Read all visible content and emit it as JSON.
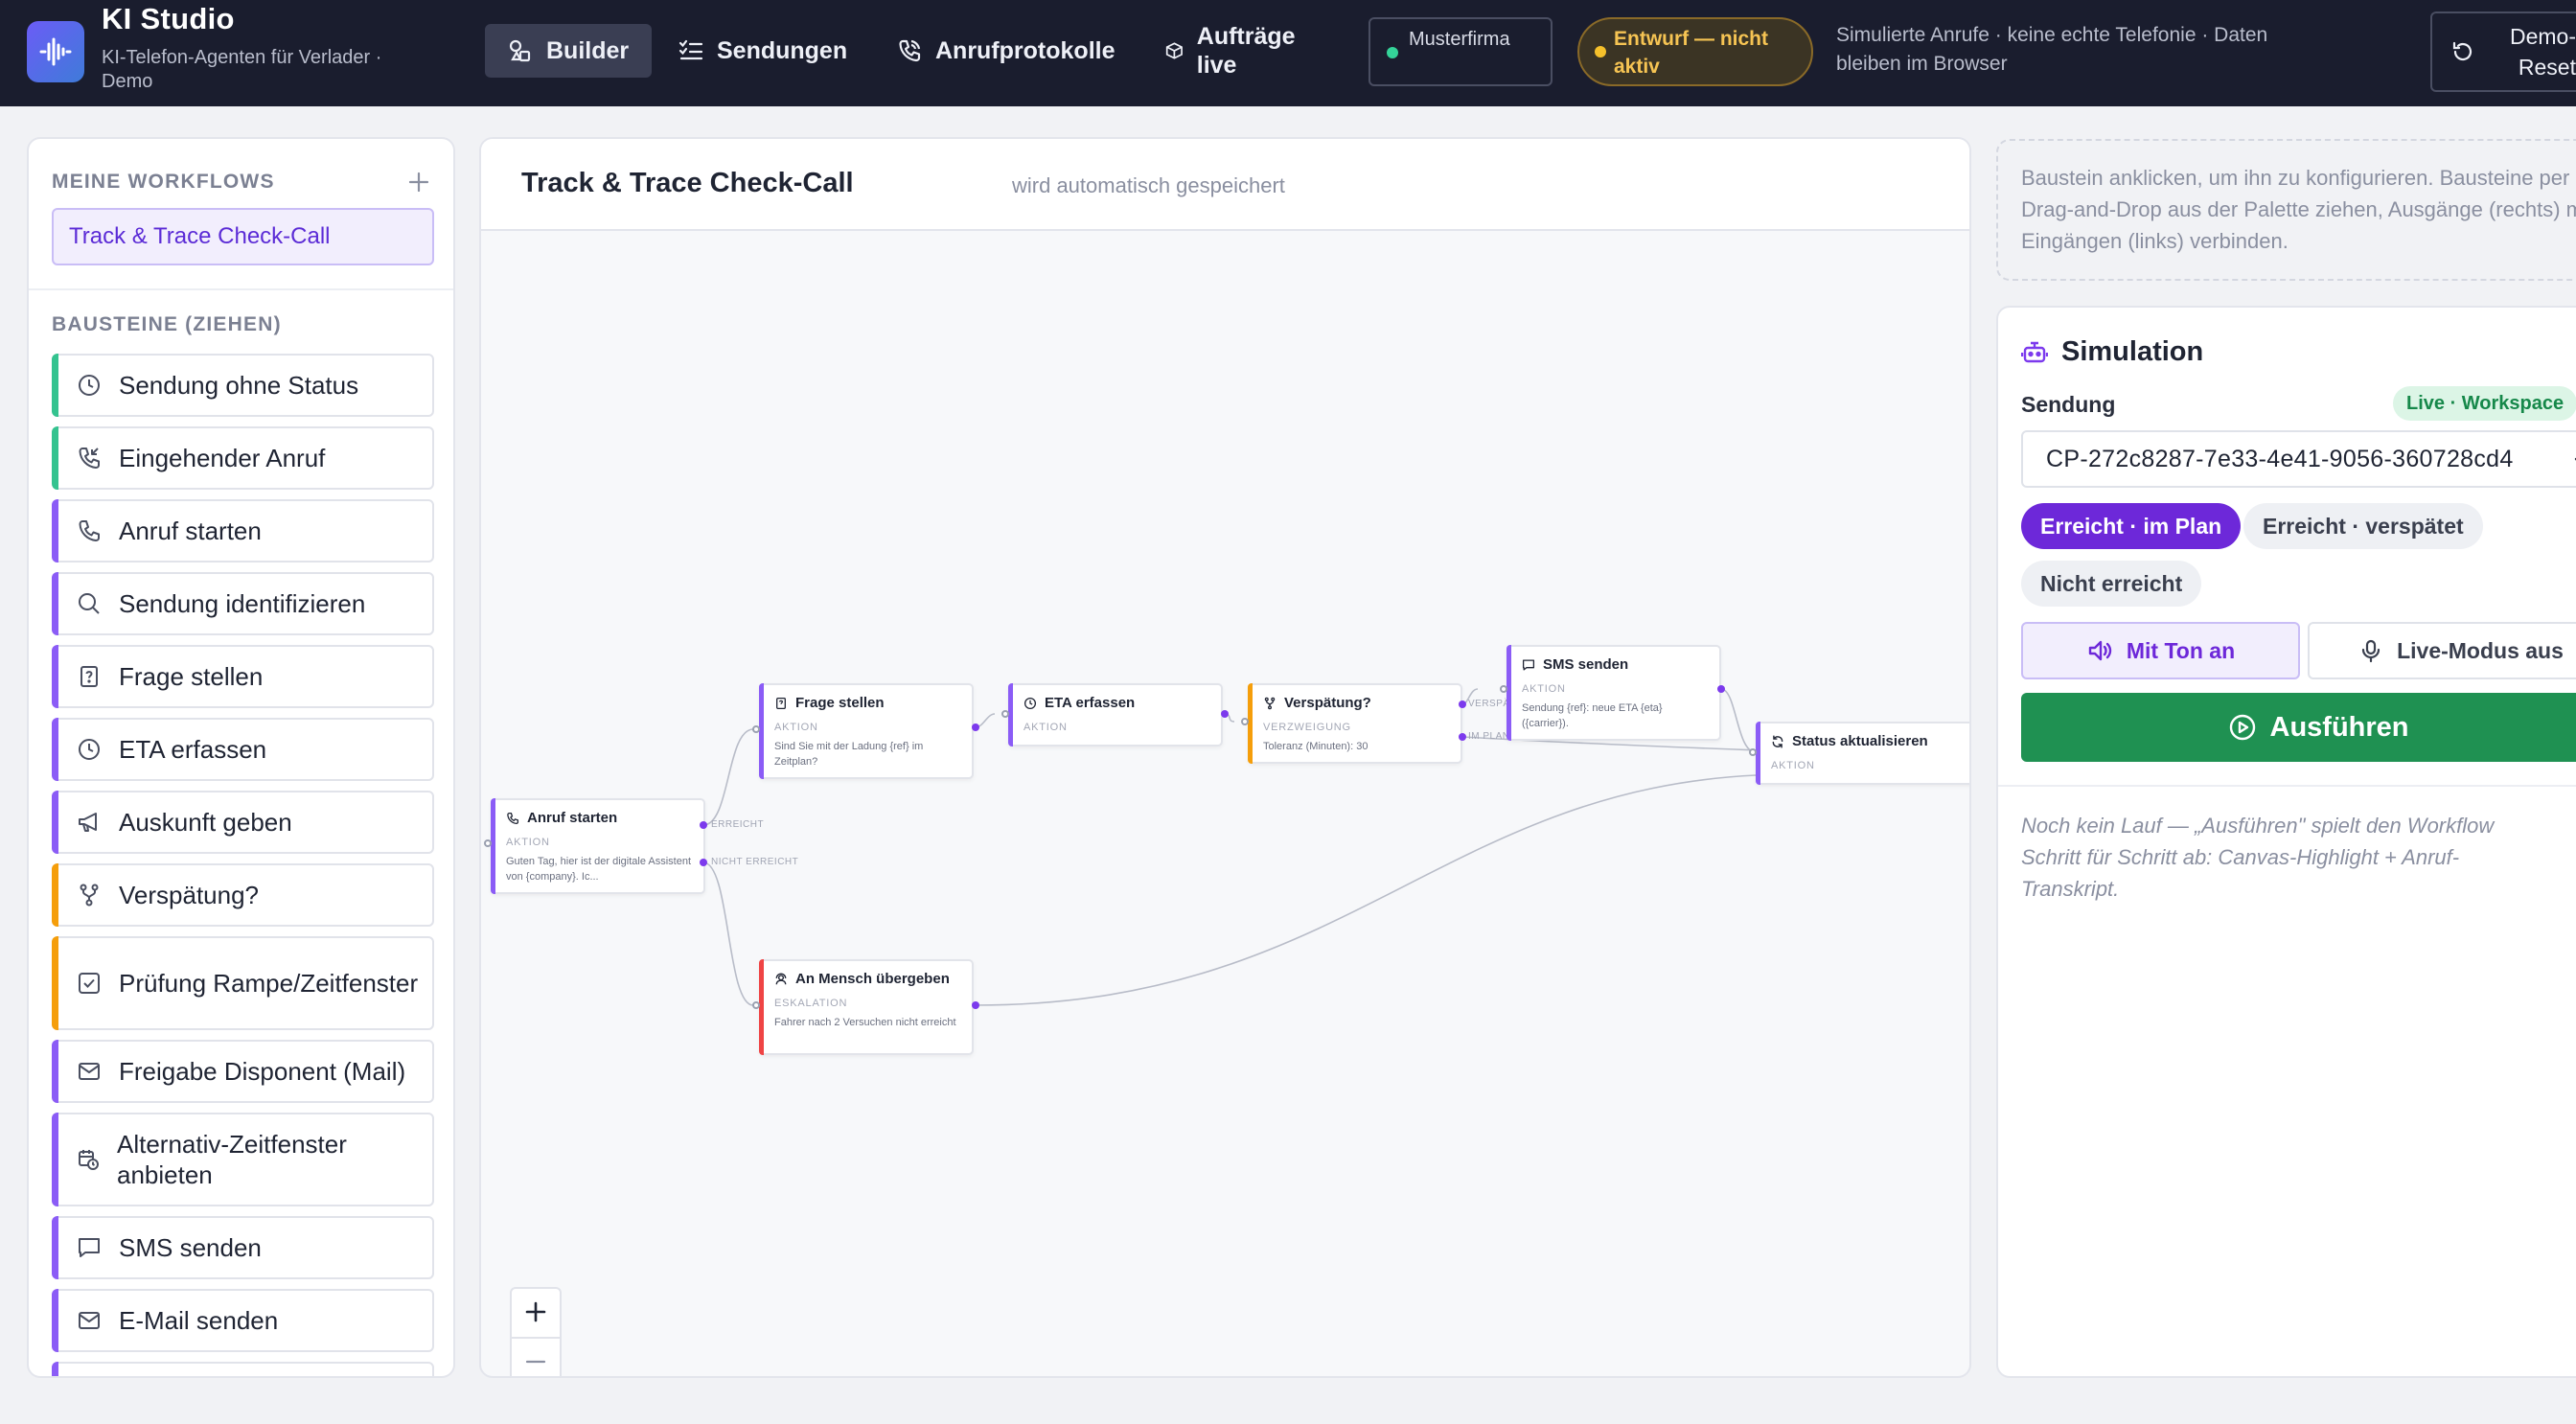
{
  "header": {
    "title": "KI Studio",
    "subtitle": "KI-Telefon-Agenten für Verlader · Demo",
    "nav": [
      {
        "label": "Builder",
        "icon": "shapes-icon",
        "active": true
      },
      {
        "label": "Sendungen",
        "icon": "checklist-icon"
      },
      {
        "label": "Anrufprotokolle",
        "icon": "phone-icon"
      },
      {
        "label": "Aufträge live",
        "icon": "package-icon"
      }
    ],
    "company": "Musterfirma",
    "status": "Entwurf — nicht aktiv",
    "note": "Simulierte Anrufe · keine echte Telefonie · Daten bleiben im Browser",
    "reset_label": "Demo-Reset"
  },
  "sidebar": {
    "workflows_title": "MEINE WORKFLOWS",
    "workflows": [
      "Track & Trace Check-Call"
    ],
    "palette_title": "BAUSTEINE (ZIEHEN)",
    "palette": [
      {
        "label": "Sendung ohne Status",
        "icon": "clock-icon",
        "accent": "#34c38f"
      },
      {
        "label": "Eingehender Anruf",
        "icon": "phone-incoming-icon",
        "accent": "#34c38f"
      },
      {
        "label": "Anruf starten",
        "icon": "phone-icon",
        "accent": "#8b5cf6"
      },
      {
        "label": "Sendung identifizieren",
        "icon": "search-icon",
        "accent": "#8b5cf6"
      },
      {
        "label": "Frage stellen",
        "icon": "question-file-icon",
        "accent": "#8b5cf6"
      },
      {
        "label": "ETA erfassen",
        "icon": "clock-icon",
        "accent": "#8b5cf6"
      },
      {
        "label": "Auskunft geben",
        "icon": "megaphone-icon",
        "accent": "#8b5cf6"
      },
      {
        "label": "Verspätung?",
        "icon": "branch-icon",
        "accent": "#f59e0b"
      },
      {
        "label": "Prüfung Rampe/Zeitfenster",
        "icon": "checkbox-icon",
        "accent": "#f59e0b"
      },
      {
        "label": "Freigabe Disponent (Mail)",
        "icon": "mail-icon",
        "accent": "#8b5cf6"
      },
      {
        "label": "Alternativ-Zeitfenster anbieten",
        "icon": "calendar-clock-icon",
        "accent": "#8b5cf6"
      },
      {
        "label": "SMS senden",
        "icon": "message-icon",
        "accent": "#8b5cf6"
      },
      {
        "label": "E-Mail senden",
        "icon": "mail-icon",
        "accent": "#8b5cf6"
      }
    ]
  },
  "canvas": {
    "title": "Track & Trace Check-Call",
    "saved": "wird automatisch gespeichert",
    "nodes": {
      "start": {
        "title": "Anruf starten",
        "type": "AKTION",
        "desc": "Guten Tag, hier ist der digitale Assistent von {company}. Ic...",
        "accent": "#8b5cf6"
      },
      "question": {
        "title": "Frage stellen",
        "type": "AKTION",
        "desc": "Sind Sie mit der Ladung {ref} im Zeitplan?",
        "accent": "#8b5cf6"
      },
      "eta": {
        "title": "ETA erfassen",
        "type": "AKTION",
        "desc": "",
        "accent": "#8b5cf6"
      },
      "delay": {
        "title": "Verspätung?",
        "type": "VERZWEIGUNG",
        "desc": "Toleranz (Minuten): 30",
        "accent": "#f59e0b"
      },
      "sms": {
        "title": "SMS senden",
        "type": "AKTION",
        "desc": "Sendung {ref}: neue ETA {eta} ({carrier}).",
        "accent": "#8b5cf6"
      },
      "status": {
        "title": "Status aktualisieren",
        "type": "AKTION",
        "desc": "",
        "accent": "#8b5cf6"
      },
      "human": {
        "title": "An Mensch übergeben",
        "type": "ESKALATION",
        "desc": "Fahrer nach 2 Versuchen nicht erreicht",
        "accent": "#ef4444"
      }
    },
    "ports": {
      "reached": "ERREICHT",
      "not_reached": "NICHT ERREICHT",
      "late": "VERSPÄTET",
      "on_plan": "IM PLAN"
    }
  },
  "inspector": {
    "hint": "Baustein anklicken, um ihn zu konfigurieren. Bausteine per Drag-and-Drop aus der Palette ziehen, Ausgänge (rechts) mit Eingängen (links) verbinden."
  },
  "simulation": {
    "title": "Simulation",
    "shipment_label": "Sendung",
    "badge": "Live · Workspace",
    "shipment_value": "CP-272c8287-7e33-4e41-9056-360728cd4",
    "scenarios": [
      {
        "label": "Erreicht · im Plan",
        "active": true
      },
      {
        "label": "Erreicht · verspätet",
        "active": false
      },
      {
        "label": "Nicht erreicht",
        "active": false
      }
    ],
    "sound_label": "Mit Ton an",
    "live_label": "Live-Modus aus",
    "run_label": "Ausführen",
    "empty_text": "Noch kein Lauf — „Ausführen\" spielt den Workflow Schritt für Schritt ab: Canvas-Highlight + Anruf-Transkript."
  },
  "colors": {
    "accent": "#6d28d9",
    "run": "#1f9152",
    "topbar": "#1a1d2e"
  }
}
